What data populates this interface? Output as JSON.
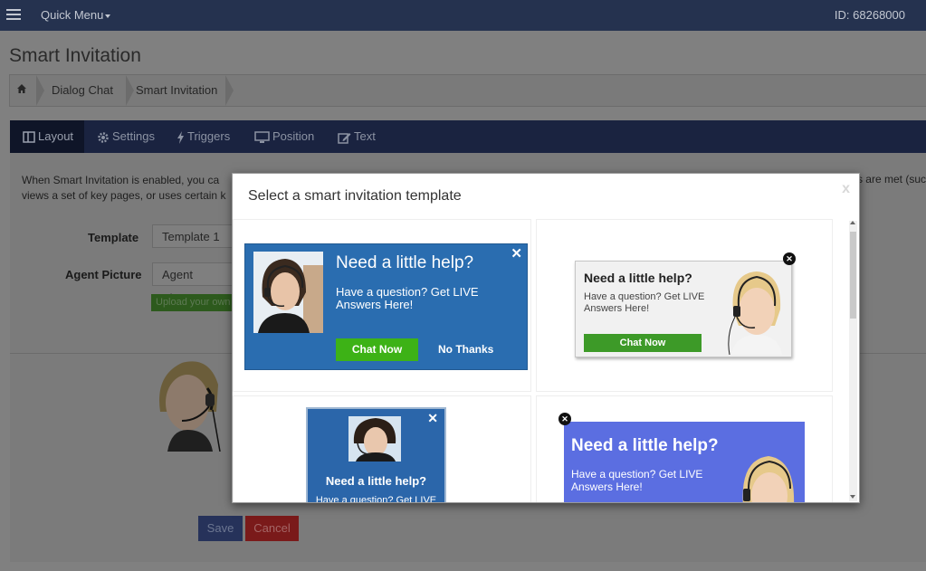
{
  "topbar": {
    "menu_label": "Quick Menu",
    "id_text": "ID: 68268000"
  },
  "page": {
    "title": "Smart Invitation"
  },
  "breadcrumb": {
    "items": [
      "Dialog Chat",
      "Smart Invitation"
    ]
  },
  "tabs": [
    {
      "label": "Layout",
      "icon": "layout-icon",
      "active": true
    },
    {
      "label": "Settings",
      "icon": "gear-icon",
      "active": false
    },
    {
      "label": "Triggers",
      "icon": "bolt-icon",
      "active": false
    },
    {
      "label": "Position",
      "icon": "monitor-icon",
      "active": false
    },
    {
      "label": "Text",
      "icon": "edit-icon",
      "active": false
    }
  ],
  "content": {
    "description_line1": "When Smart Invitation is enabled, you ca",
    "description_line2": "views a set of key pages, or uses certain k",
    "description_right": "s are met (suc",
    "template_label": "Template",
    "template_value": "Template 1",
    "agent_picture_label": "Agent Picture",
    "agent_picture_value": "Agent Picture",
    "upload_label": "Upload your own"
  },
  "actions": {
    "save": "Save",
    "cancel": "Cancel"
  },
  "modal": {
    "title": "Select a smart invitation template",
    "close": "x",
    "templates": [
      {
        "title": "Need a little help?",
        "subtitle": "Have a question? Get LIVE Answers Here!",
        "chat_button": "Chat Now",
        "decline_button": "No Thanks",
        "close": "✕"
      },
      {
        "title": "Need a little help?",
        "subtitle": "Have a question? Get LIVE Answers Here!",
        "chat_button": "Chat Now",
        "close": "✕"
      },
      {
        "title": "Need a little help?",
        "subtitle": "Have a question? Get LIVE",
        "close": "✕"
      },
      {
        "title": "Need a little help?",
        "subtitle": "Have a question? Get LIVE Answers Here!",
        "close": "✕"
      }
    ]
  },
  "colors": {
    "topbar": "#25324f",
    "tab_active": "#0f1528",
    "template1_bg": "#2a6db0",
    "chat_green": "#3db216",
    "template4_bg": "#5b6ee1"
  }
}
